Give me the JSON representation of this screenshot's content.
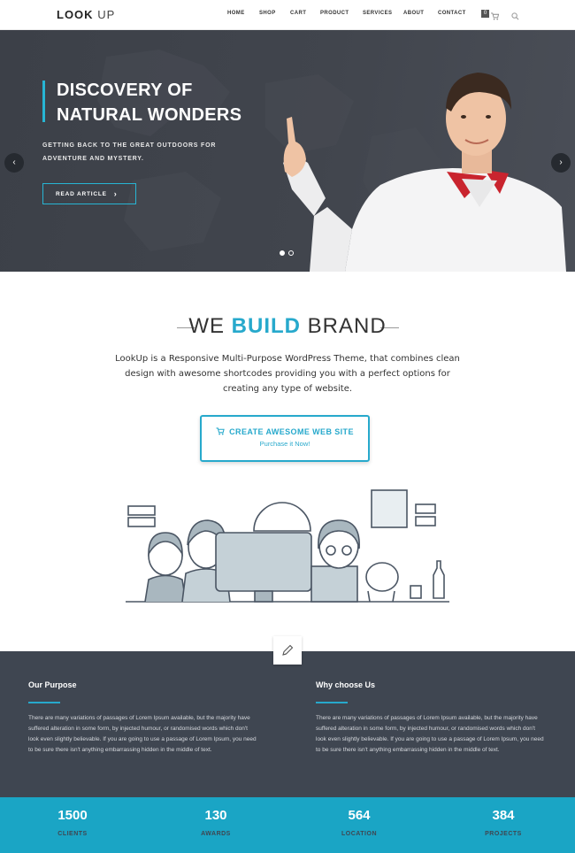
{
  "header": {
    "logo_bold": "LOOK",
    "logo_thin": "UP",
    "nav": [
      "HOME",
      "SHOP",
      "CART",
      "PRODUCT",
      "SERVICES",
      "ABOUT",
      "CONTACT"
    ],
    "cart_count": "0"
  },
  "hero": {
    "title_line1": "DISCOVERY OF",
    "title_line2": "NATURAL WONDERS",
    "subtitle_line1": "GETTING BACK TO THE GREAT OUTDOORS FOR",
    "subtitle_line2": "ADVENTURE AND MYSTERY.",
    "button_label": "READ ARTICLE",
    "slides_total": 2,
    "active_slide": 1
  },
  "brand": {
    "title_before": "WE",
    "title_highlight": "BUILD",
    "title_after": "BRAND",
    "description": "LookUp is a Responsive Multi-Purpose WordPress Theme, that combines clean design with awesome shortcodes providing you with a perfect options for creating any type of website.",
    "cta_title": "CREATE AWESOME WEB SITE",
    "cta_subtitle": "Purchase it Now!"
  },
  "info": {
    "left_title": "Our Purpose",
    "left_text": "There are many variations of passages of Lorem Ipsum available, but the majority have suffered alteration in some form, by injected humour, or randomised words which don't look even slightly believable. If you are going to use a passage of Lorem Ipsum, you need to be sure there isn't anything embarrassing hidden in the middle of text.",
    "right_title": "Why choose Us",
    "right_text": "There are many variations of passages of Lorem Ipsum available, but the majority have suffered alteration in some form, by injected humour, or randomised words which don't look even slightly believable. If you are going to use a passage of Lorem Ipsum, you need to be sure there isn't anything embarrassing hidden in the middle of text."
  },
  "stats": [
    {
      "number": "1500",
      "label": "CLIENTS"
    },
    {
      "number": "130",
      "label": "AWARDS"
    },
    {
      "number": "564",
      "label": "LOCATION"
    },
    {
      "number": "384",
      "label": "PROJECTS"
    }
  ],
  "colors": {
    "accent": "#27a9cc",
    "dark": "#3f4651",
    "stats_bg": "#1aa5c5"
  },
  "icons": [
    "cart-icon",
    "search-icon",
    "chevron-left-icon",
    "chevron-right-icon",
    "chevron-right-small-icon",
    "shopping-cart-icon",
    "pencil-icon"
  ]
}
